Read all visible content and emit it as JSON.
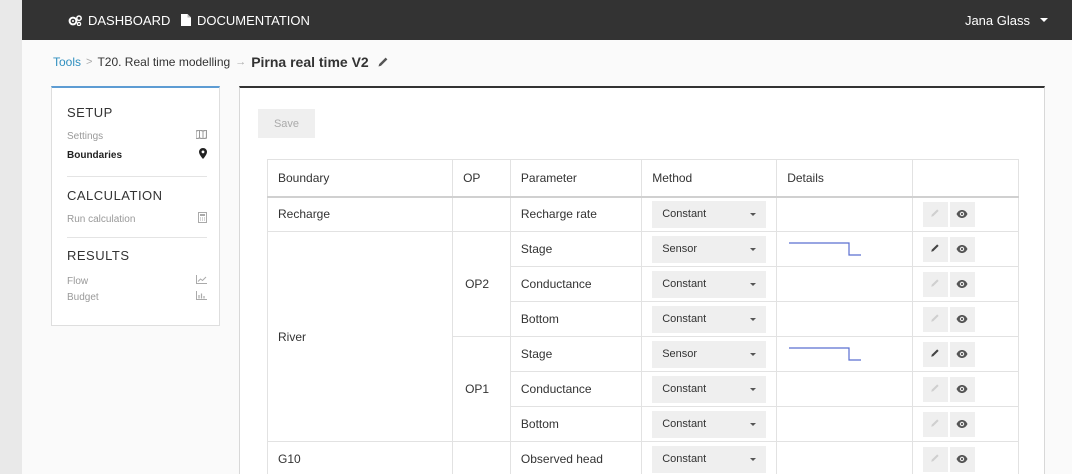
{
  "topbar": {
    "dashboard_label": "DASHBOARD",
    "documentation_label": "DOCUMENTATION",
    "user_name": "Jana Glass"
  },
  "breadcrumb": {
    "tools": "Tools",
    "project": "T20. Real time modelling",
    "current": "Pirna real time V2"
  },
  "sidebar": {
    "setup_title": "SETUP",
    "settings": "Settings",
    "boundaries": "Boundaries",
    "calculation_title": "CALCULATION",
    "run_calculation": "Run calculation",
    "results_title": "RESULTS",
    "flow": "Flow",
    "budget": "Budget"
  },
  "toolbar": {
    "save_label": "Save"
  },
  "table": {
    "headers": {
      "boundary": "Boundary",
      "op": "OP",
      "parameter": "Parameter",
      "method": "Method",
      "details": "Details"
    },
    "rows": [
      {
        "boundary": "Recharge",
        "op": "",
        "parameter": "Recharge rate",
        "method": "Constant"
      },
      {
        "boundary": "River",
        "op": "OP2",
        "parameter": "Stage",
        "method": "Sensor"
      },
      {
        "boundary": "",
        "op": "",
        "parameter": "Conductance",
        "method": "Constant"
      },
      {
        "boundary": "",
        "op": "",
        "parameter": "Bottom",
        "method": "Constant"
      },
      {
        "boundary": "",
        "op": "OP1",
        "parameter": "Stage",
        "method": "Sensor"
      },
      {
        "boundary": "",
        "op": "",
        "parameter": "Conductance",
        "method": "Constant"
      },
      {
        "boundary": "",
        "op": "",
        "parameter": "Bottom",
        "method": "Constant"
      },
      {
        "boundary": "G10",
        "op": "",
        "parameter": "Observed head",
        "method": "Constant"
      }
    ]
  },
  "colors": {
    "topbar_bg": "#333333",
    "link": "#2f8fbf",
    "sidebar_accent": "#5d9cd3",
    "sparkline": "#5a6fd0"
  }
}
